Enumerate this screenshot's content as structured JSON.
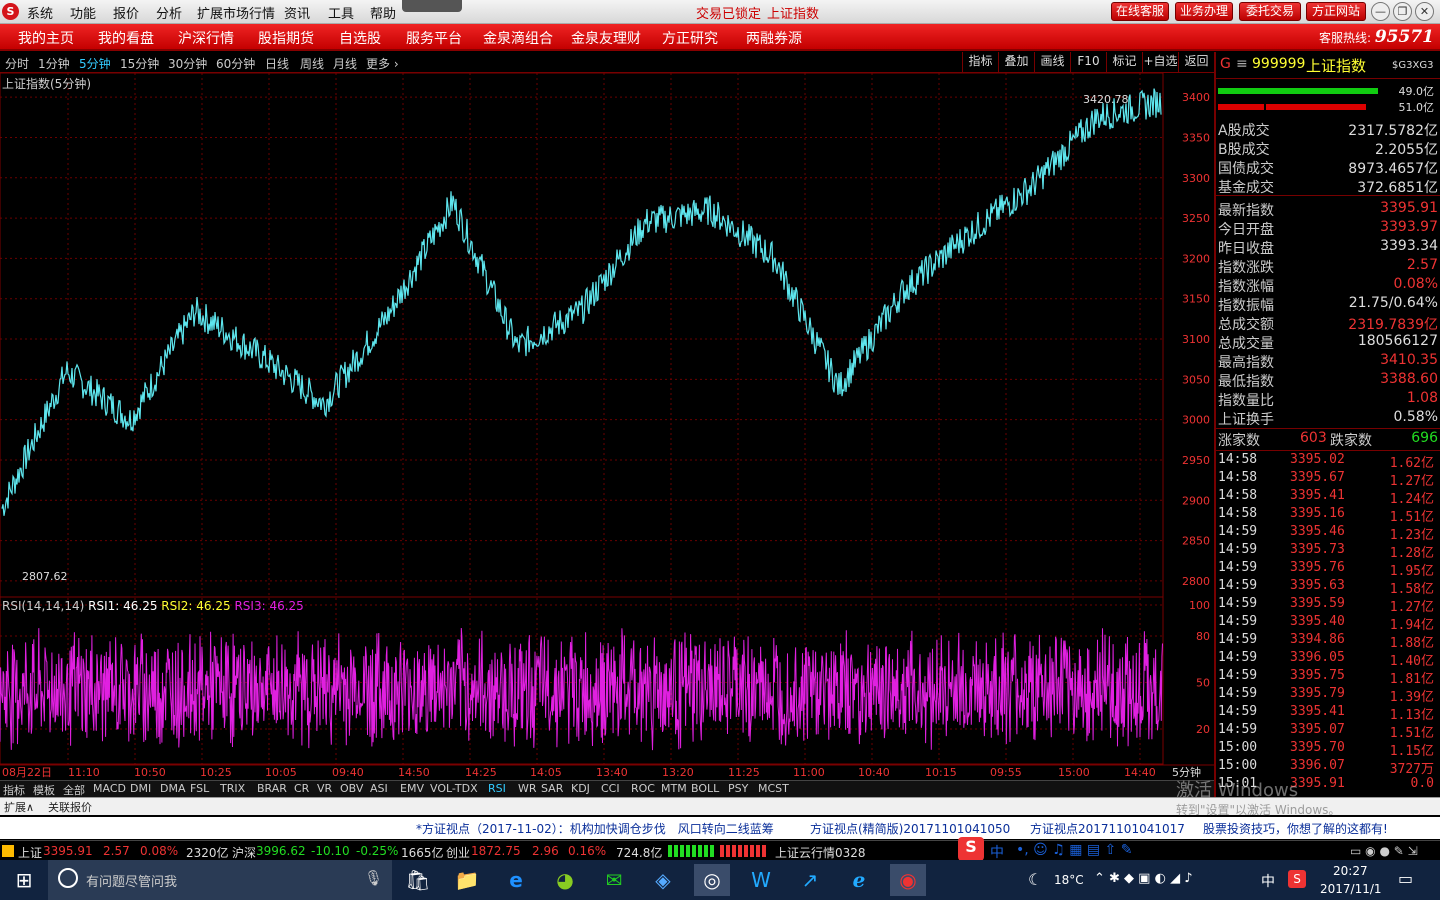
{
  "menubar": {
    "logo": "S",
    "items": [
      "系统",
      "功能",
      "报价",
      "分析",
      "扩展市场行情",
      "资讯",
      "工具",
      "帮助"
    ],
    "status1": "交易已锁定",
    "status2": "上证指数",
    "buttons": [
      "在线客服",
      "业务办理",
      "委托交易",
      "方正网站"
    ],
    "win_buttons": [
      "—",
      "❐",
      "✕"
    ]
  },
  "nav": {
    "items": [
      "我的主页",
      "我的看盘",
      "沪深行情",
      "股指期货",
      "自选股",
      "服务平台",
      "金泉滴组合",
      "金泉友理财",
      "方正研究",
      "两融券源"
    ],
    "hotline_label": "客服热线:",
    "hotline_number": "95571"
  },
  "periods": [
    "分时",
    "1分钟",
    "5分钟",
    "15分钟",
    "30分钟",
    "60分钟",
    "日线",
    "周线",
    "月线",
    "更多 ›"
  ],
  "toolbar": [
    "指标",
    "叠加",
    "画线",
    "F10",
    "标记",
    "+自选",
    "返回"
  ],
  "chart": {
    "title": "上证指数(5分钟)",
    "max_label": "3420.78",
    "min_label": "2807.62",
    "rsi_title": "RSI(14,14,14)",
    "rsi1": "RSI1: 46.25",
    "rsi2": "RSI2: 46.25",
    "rsi3": "RSI3: 46.25",
    "time_labels": [
      "08月22日",
      "11:10",
      "10:50",
      "10:25",
      "10:05",
      "09:40",
      "14:50",
      "14:25",
      "14:05",
      "13:40",
      "13:20",
      "11:25",
      "11:00",
      "10:40",
      "10:15",
      "09:55",
      "15:00",
      "14:40"
    ],
    "period_label": "5分钟"
  },
  "chart_data": [
    {
      "type": "line",
      "title": "上证指数(5分钟)",
      "ylim": [
        2780,
        3430
      ],
      "yticks": [
        2800,
        2850,
        2900,
        2950,
        3000,
        3050,
        3100,
        3150,
        3200,
        3250,
        3300,
        3350,
        3400
      ],
      "x": [
        "08月22日",
        "11:10",
        "10:50",
        "10:25",
        "10:05",
        "09:40",
        "14:50",
        "14:25",
        "14:05",
        "13:40",
        "13:20",
        "11:25",
        "11:00",
        "10:40",
        "10:15",
        "09:55",
        "15:00",
        "14:40"
      ],
      "series": [
        {
          "values": [
            2890,
            3060,
            3000,
            3135,
            3080,
            3020,
            3130,
            3270,
            3090,
            3135,
            3245,
            3260,
            3200,
            3040,
            3160,
            3230,
            3290,
            3375,
            3395
          ]
        }
      ],
      "annotations": {
        "max": 3420.78,
        "min": 2807.62
      },
      "grid": true
    },
    {
      "type": "line",
      "title": "RSI(14,14,14)",
      "ylim": [
        0,
        100
      ],
      "yticks": [
        20,
        50,
        80,
        100
      ],
      "series": [
        {
          "name": "RSI1",
          "values": [
            46.25
          ]
        },
        {
          "name": "RSI2",
          "values": [
            46.25
          ]
        },
        {
          "name": "RSI3",
          "values": [
            46.25
          ]
        }
      ],
      "grid": true
    }
  ],
  "rightpanel": {
    "code": "999999",
    "name": "上证指数",
    "tag": "$G3XG3",
    "bar1": "49.0亿",
    "bar2": "51.0亿",
    "rows": [
      {
        "k": "A股成交",
        "v": "2317.5782亿"
      },
      {
        "k": "B股成交",
        "v": "2.2055亿"
      },
      {
        "k": "国债成交",
        "v": "8973.4657亿"
      },
      {
        "k": "基金成交",
        "v": "372.6851亿"
      },
      {
        "k": "最新指数",
        "v": "3395.91"
      },
      {
        "k": "今日开盘",
        "v": "3393.97"
      },
      {
        "k": "昨日收盘",
        "v": "3393.34"
      },
      {
        "k": "指数涨跌",
        "v": "2.57"
      },
      {
        "k": "指数涨幅",
        "v": "0.08%"
      },
      {
        "k": "指数振幅",
        "v": "21.75/0.64%"
      },
      {
        "k": "总成交额",
        "v": "2319.7839亿"
      },
      {
        "k": "总成交量",
        "v": "180566127"
      },
      {
        "k": "最高指数",
        "v": "3410.35"
      },
      {
        "k": "最低指数",
        "v": "3388.60"
      },
      {
        "k": "指数量比",
        "v": "1.08"
      },
      {
        "k": "上证换手",
        "v": "0.58%"
      }
    ],
    "up_label": "涨家数",
    "up_count": "603",
    "down_label": "跌家数",
    "down_count": "696",
    "ticks": [
      {
        "t": "14:58",
        "p": "3395.02",
        "a": "1.62亿"
      },
      {
        "t": "14:58",
        "p": "3395.67",
        "a": "1.27亿"
      },
      {
        "t": "14:58",
        "p": "3395.41",
        "a": "1.24亿"
      },
      {
        "t": "14:58",
        "p": "3395.16",
        "a": "1.51亿"
      },
      {
        "t": "14:59",
        "p": "3395.46",
        "a": "1.23亿"
      },
      {
        "t": "14:59",
        "p": "3395.73",
        "a": "1.28亿"
      },
      {
        "t": "14:59",
        "p": "3395.76",
        "a": "1.95亿"
      },
      {
        "t": "14:59",
        "p": "3395.63",
        "a": "1.58亿"
      },
      {
        "t": "14:59",
        "p": "3395.59",
        "a": "1.27亿"
      },
      {
        "t": "14:59",
        "p": "3395.40",
        "a": "1.94亿"
      },
      {
        "t": "14:59",
        "p": "3394.86",
        "a": "1.88亿"
      },
      {
        "t": "14:59",
        "p": "3396.05",
        "a": "1.40亿"
      },
      {
        "t": "14:59",
        "p": "3395.75",
        "a": "1.81亿"
      },
      {
        "t": "14:59",
        "p": "3395.79",
        "a": "1.39亿"
      },
      {
        "t": "14:59",
        "p": "3395.41",
        "a": "1.13亿"
      },
      {
        "t": "14:59",
        "p": "3395.07",
        "a": "1.51亿"
      },
      {
        "t": "15:00",
        "p": "3395.70",
        "a": "1.15亿"
      },
      {
        "t": "15:00",
        "p": "3396.07",
        "a": "3727万"
      },
      {
        "t": "15:01",
        "p": "3395.91",
        "a": "0.0"
      }
    ],
    "bottom_tabs": [
      "笔",
      "价",
      "细",
      "势",
      "联",
      "值",
      "主",
      "筹"
    ]
  },
  "indicators": [
    "指标",
    "模板",
    "全部",
    "MACD",
    "DMI",
    "DMA",
    "FSL",
    "TRIX",
    "BRAR",
    "CR",
    "VR",
    "OBV",
    "ASI",
    "EMV",
    "VOL-TDX",
    "RSI",
    "WR",
    "SAR",
    "KDJ",
    "CCI",
    "ROC",
    "MTM",
    "BOLL",
    "PSY",
    "MCST"
  ],
  "bottombar": {
    "left1": "扩展∧",
    "left2": "关联报价"
  },
  "watermark": {
    "line1": "激活 Windows",
    "line2": "转到\"设置\"以激活 Windows。"
  },
  "news": [
    "*方证视点（2017-11-02）：机构加快调仓步伐　风口转向二线蓝筹",
    "方证视点(精简版)20171101041050",
    "方证视点20171101041017",
    "股票投资技巧，你想了解的这都有!"
  ],
  "status": {
    "sh_label": "上证",
    "sh_val": "3395.91",
    "sh_chg": "2.57",
    "sh_pct": "0.08%",
    "sh_amt": "2320亿",
    "hs_label": "沪深",
    "hs_val": "3996.62",
    "hs_chg": "-10.10",
    "hs_pct": "-0.25%",
    "hs_amt": "1665亿",
    "cy_label": "创业",
    "cy_val": "1872.75",
    "cy_chg": "2.96",
    "cy_pct": "0.16%",
    "cy_amt": "724.8亿",
    "cloud": "上证云行情0328",
    "ime": "中"
  },
  "taskbar": {
    "search_placeholder": "有问题尽管问我",
    "weather": "18°C",
    "lang": "中",
    "time": "20:27",
    "date": "2017/11/1"
  },
  "colors": {
    "price_line": "#5ee6ee",
    "rsi_line": "#e020e0",
    "grid": "#7a0000",
    "red_bar": "#c00000",
    "accent": "#e02020"
  }
}
